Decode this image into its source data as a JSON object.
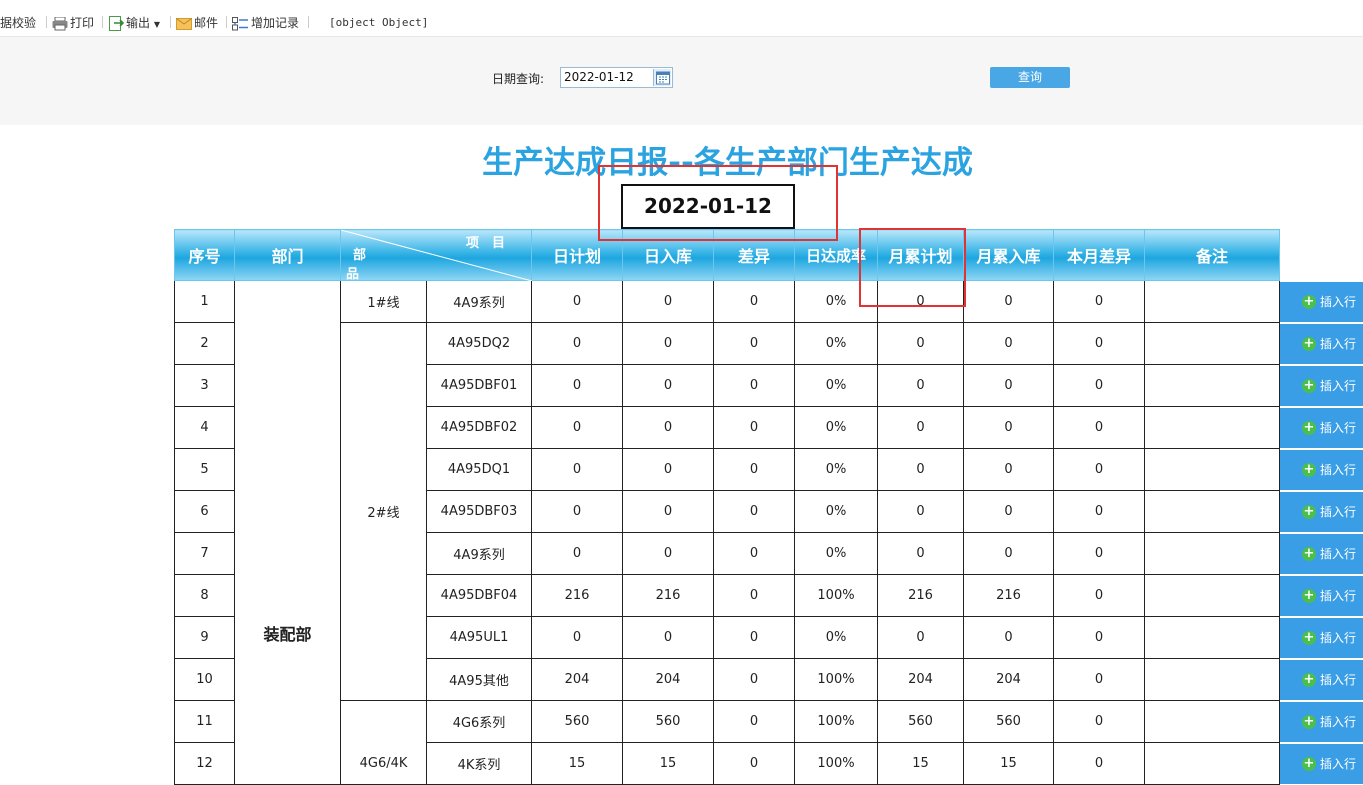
{
  "toolbar": {
    "items": [
      {
        "label": "据校验",
        "icon": "verify-icon"
      },
      {
        "label": "打印",
        "icon": "printer-icon"
      },
      {
        "label": "输出",
        "icon": "export-icon"
      },
      {
        "label": "邮件",
        "icon": "mail-icon"
      },
      {
        "label": "增加记录",
        "icon": "add-record-icon"
      }
    ],
    "object_text": "[object Object]"
  },
  "query": {
    "label": "日期查询:",
    "date_value": "2022-01-12",
    "button_label": "查询"
  },
  "report": {
    "title": "生产达成日报--各生产部门生产达成",
    "date": "2022-01-12",
    "headers": {
      "seq": "序号",
      "dept": "部门",
      "diag_top": "项　目",
      "diag_mid": "部",
      "diag_bot": "品",
      "day_plan": "日计划",
      "day_in": "日入库",
      "diff": "差异",
      "day_rate": "日达成率",
      "month_plan": "月累计划",
      "month_in": "月累入库",
      "month_diff": "本月差异",
      "remark": "备注"
    },
    "department": "装配部",
    "lines": [
      "1#线",
      "2#线",
      "4G6/4K"
    ],
    "rows": [
      {
        "seq": "1",
        "product": "4A9系列",
        "day_plan": "0",
        "day_in": "0",
        "diff": "0",
        "rate": "0%",
        "m_plan": "0",
        "m_in": "0",
        "m_diff": "0",
        "remark": ""
      },
      {
        "seq": "2",
        "product": "4A95DQ2",
        "day_plan": "0",
        "day_in": "0",
        "diff": "0",
        "rate": "0%",
        "m_plan": "0",
        "m_in": "0",
        "m_diff": "0",
        "remark": ""
      },
      {
        "seq": "3",
        "product": "4A95DBF01",
        "day_plan": "0",
        "day_in": "0",
        "diff": "0",
        "rate": "0%",
        "m_plan": "0",
        "m_in": "0",
        "m_diff": "0",
        "remark": ""
      },
      {
        "seq": "4",
        "product": "4A95DBF02",
        "day_plan": "0",
        "day_in": "0",
        "diff": "0",
        "rate": "0%",
        "m_plan": "0",
        "m_in": "0",
        "m_diff": "0",
        "remark": ""
      },
      {
        "seq": "5",
        "product": "4A95DQ1",
        "day_plan": "0",
        "day_in": "0",
        "diff": "0",
        "rate": "0%",
        "m_plan": "0",
        "m_in": "0",
        "m_diff": "0",
        "remark": ""
      },
      {
        "seq": "6",
        "product": "4A95DBF03",
        "day_plan": "0",
        "day_in": "0",
        "diff": "0",
        "rate": "0%",
        "m_plan": "0",
        "m_in": "0",
        "m_diff": "0",
        "remark": ""
      },
      {
        "seq": "7",
        "product": "4A9系列",
        "day_plan": "0",
        "day_in": "0",
        "diff": "0",
        "rate": "0%",
        "m_plan": "0",
        "m_in": "0",
        "m_diff": "0",
        "remark": ""
      },
      {
        "seq": "8",
        "product": "4A95DBF04",
        "day_plan": "216",
        "day_in": "216",
        "diff": "0",
        "rate": "100%",
        "m_plan": "216",
        "m_in": "216",
        "m_diff": "0",
        "remark": ""
      },
      {
        "seq": "9",
        "product": "4A95UL1",
        "day_plan": "0",
        "day_in": "0",
        "diff": "0",
        "rate": "0%",
        "m_plan": "0",
        "m_in": "0",
        "m_diff": "0",
        "remark": ""
      },
      {
        "seq": "10",
        "product": "4A95其他",
        "day_plan": "204",
        "day_in": "204",
        "diff": "0",
        "rate": "100%",
        "m_plan": "204",
        "m_in": "204",
        "m_diff": "0",
        "remark": ""
      },
      {
        "seq": "11",
        "product": "4G6系列",
        "day_plan": "560",
        "day_in": "560",
        "diff": "0",
        "rate": "100%",
        "m_plan": "560",
        "m_in": "560",
        "m_diff": "0",
        "remark": ""
      },
      {
        "seq": "12",
        "product": "4K系列",
        "day_plan": "15",
        "day_in": "15",
        "diff": "0",
        "rate": "100%",
        "m_plan": "15",
        "m_in": "15",
        "m_diff": "0",
        "remark": ""
      }
    ],
    "insert_label": "插入行"
  }
}
